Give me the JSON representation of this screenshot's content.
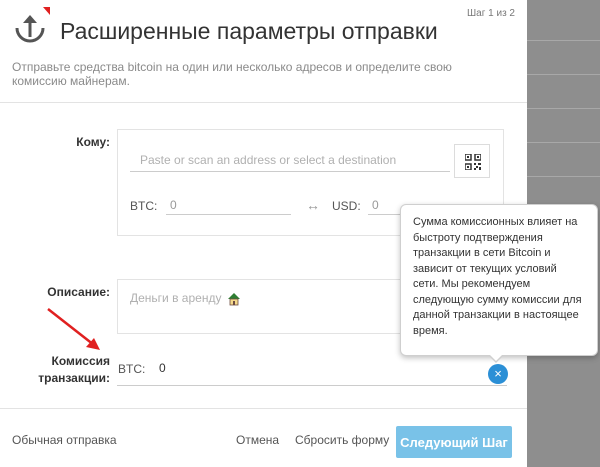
{
  "header": {
    "step": "Шаг 1 из 2",
    "title": "Расширенные параметры отправки",
    "subtitle": "Отправьте средства bitcoin на один или несколько адресов и определите свою комиссию майнерам.",
    "icon": "send-upload-icon"
  },
  "to": {
    "label": "Кому:",
    "address_placeholder": "Paste or scan an address or select a destination",
    "qr_icon": "qr-code-icon",
    "btc_label": "BTC:",
    "btc_value": "0",
    "swap_icon": "↔",
    "usd_label": "USD:",
    "usd_value": "0"
  },
  "description": {
    "label": "Описание:",
    "value": "Деньги в аренду"
  },
  "fee": {
    "label_line1": "Комиссия",
    "label_line2": "транзакции:",
    "btc_label": "BTC:",
    "value": "0",
    "help_icon": "×"
  },
  "tooltip": {
    "text": "Сумма комиссионных влияет на быстроту подтверждения транзакции в сети Bitcoin и зависит от текущих условий сети. Мы рекомендуем следующую сумму комиссии для данной транзакции в настоящее время."
  },
  "footer": {
    "simple_send": "Обычная отправка",
    "cancel": "Отмена",
    "reset": "Сбросить форму",
    "next": "Следующий Шаг"
  },
  "colors": {
    "accent": "#2b8fd6",
    "next_button": "#79c2e8",
    "annotation_arrow": "#e02020"
  }
}
